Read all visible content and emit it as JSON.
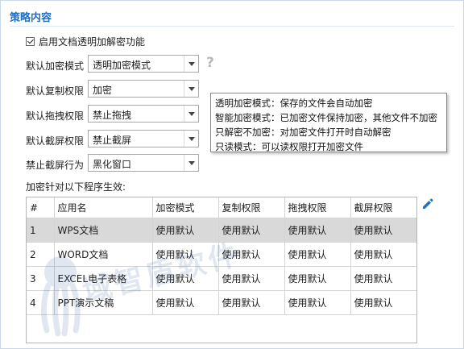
{
  "section": {
    "title": "策略内容"
  },
  "enable_checkbox": {
    "label": "启用文档透明加解密功能",
    "checked": true
  },
  "fields": [
    {
      "label": "默认加密模式",
      "value": "透明加密模式"
    },
    {
      "label": "默认复制权限",
      "value": "加密"
    },
    {
      "label": "默认拖拽权限",
      "value": "禁止拖拽"
    },
    {
      "label": "默认截屏权限",
      "value": "禁止截屏"
    },
    {
      "label": "禁止截屏行为",
      "value": "黑化窗口"
    }
  ],
  "help": {
    "icon": "help-icon",
    "glyph": "?"
  },
  "tooltip": {
    "lines": [
      "透明加密模式：保存的文件会自动加密",
      "智能加密模式：已加密文件保持加密，其他文件不加密",
      "只解密不加密：对加密文件打开时自动解密",
      "只读模式：可以读权限打开加密文件"
    ]
  },
  "applies_label": "加密针对以下程序生效:",
  "table": {
    "columns": [
      "#",
      "应用名",
      "加密模式",
      "复制权限",
      "拖拽权限",
      "截屏权限"
    ],
    "rows": [
      [
        "1",
        "WPS文档",
        "使用默认",
        "使用默认",
        "使用默认",
        "使用默认"
      ],
      [
        "2",
        "WORD文档",
        "使用默认",
        "使用默认",
        "使用默认",
        "使用默认"
      ],
      [
        "3",
        "EXCEL电子表格",
        "使用默认",
        "使用默认",
        "使用默认",
        "使用默认"
      ],
      [
        "4",
        "PPT演示文稿",
        "使用默认",
        "使用默认",
        "使用默认",
        "使用默认"
      ]
    ],
    "selected_row": 0
  },
  "watermark": {
    "text": "域智盾软件"
  },
  "colors": {
    "accent": "#1f6fc4",
    "selected_row": "#d9d9d9",
    "edit_icon": "#1a73c9"
  }
}
